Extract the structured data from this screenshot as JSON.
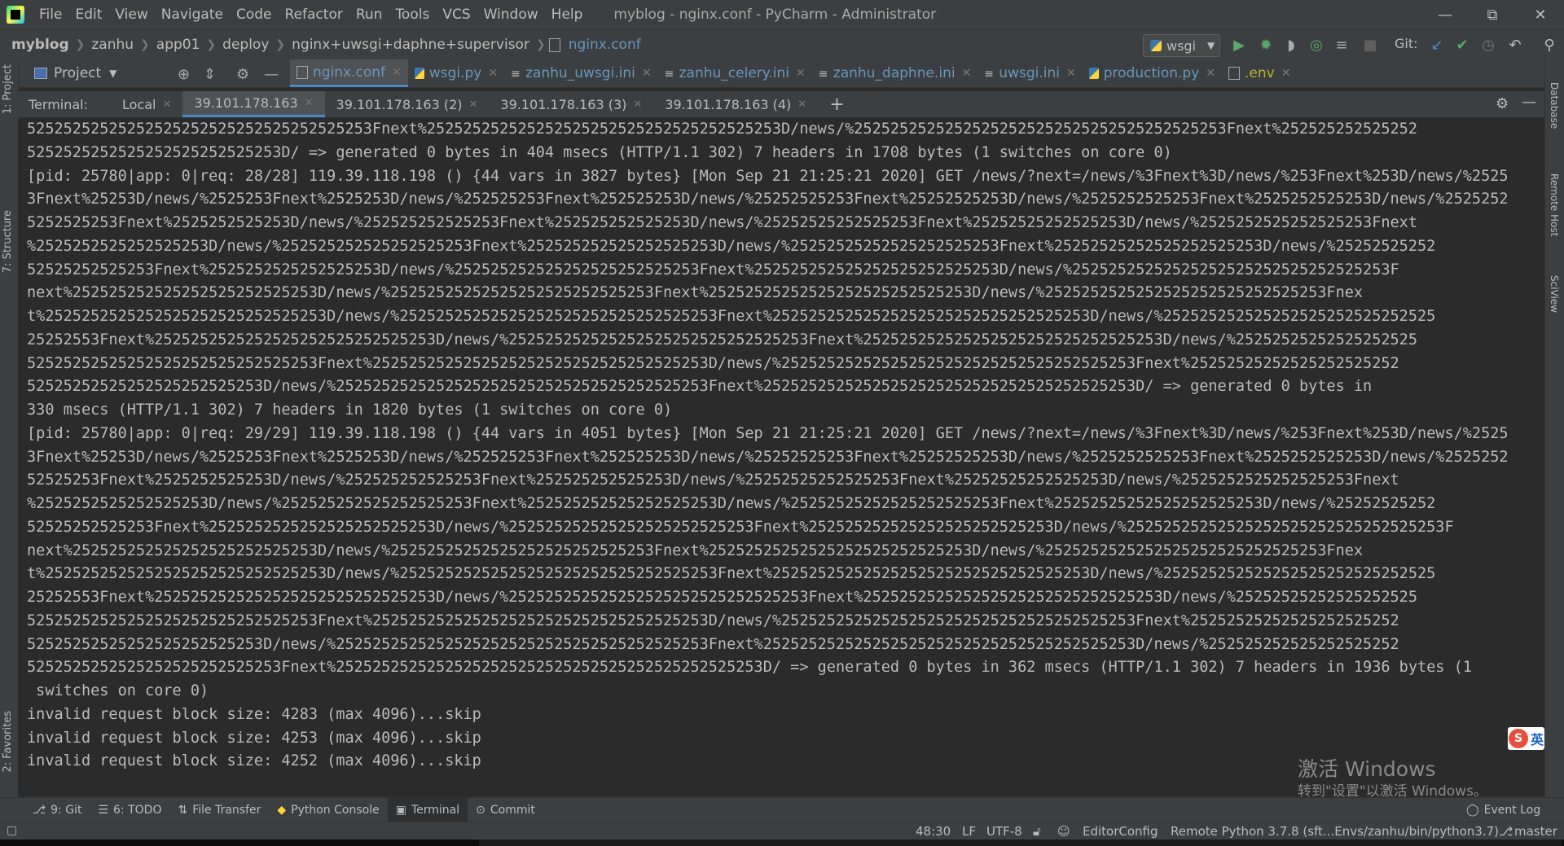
{
  "menu": [
    "File",
    "Edit",
    "View",
    "Navigate",
    "Code",
    "Refactor",
    "Run",
    "Tools",
    "VCS",
    "Window",
    "Help"
  ],
  "window_title": "myblog - nginx.conf - PyCharm - Administrator",
  "breadcrumbs": [
    "myblog",
    "zanhu",
    "app01",
    "deploy",
    "nginx+uwsgi+daphne+supervisor",
    "nginx.conf"
  ],
  "run_config": "wsgi",
  "git_label": "Git:",
  "project_label": "Project",
  "editor_tabs": [
    {
      "label": "nginx.conf"
    },
    {
      "label": "wsgi.py"
    },
    {
      "label": "zanhu_uwsgi.ini"
    },
    {
      "label": "zanhu_celery.ini"
    },
    {
      "label": "zanhu_daphne.ini"
    },
    {
      "label": "uwsgi.ini"
    },
    {
      "label": "production.py"
    },
    {
      "label": ".env"
    }
  ],
  "left_tools": [
    "1: Project",
    "7: Structure",
    "2: Favorites"
  ],
  "right_tools": [
    "Database",
    "Remote Host",
    "SciView"
  ],
  "terminal": {
    "title": "Terminal:",
    "tabs": [
      "Local",
      "39.101.178.163",
      "39.101.178.163 (2)",
      "39.101.178.163 (3)",
      "39.101.178.163 (4)"
    ],
    "lines": [
      "52525252525252525252525252525252525253Fnext%252525252525252525252525252525252525253D/news/%25252525252525252525252525252525252525253Fnext%252525252525252",
      "5252525252525252525252525253D/ => generated 0 bytes in 404 msecs (HTTP/1.1 302) 7 headers in 1708 bytes (1 switches on core 0)",
      "[pid: 25780|app: 0|req: 28/28] 119.39.118.198 () {44 vars in 3827 bytes} [Mon Sep 21 21:25:21 2020] GET /news/?next=/news/%3Fnext%3D/news/%253Fnext%253D/news/%2525",
      "3Fnext%25253D/news/%2525253Fnext%2525253D/news/%252525253Fnext%252525253D/news/%25252525253Fnext%25252525253D/news/%2525252525253Fnext%2525252525253D/news/%2525252",
      "5252525253Fnext%2525252525253D/news/%252525252525253Fnext%252525252525253D/news/%25252525252525253Fnext%25252525252525253D/news/%2525252525252525253Fnext",
      "%2525252525252525253D/news/%252525252525252525253Fnext%252525252525252525253D/news/%25252525252525252525253Fnext%25252525252525252525253D/news/%25252525252",
      "52525252525253Fnext%2525252525252525253D/news/%252525252525252525252525253Fnext%252525252525252525252525253D/news/%25252525252525252525252525252525253F",
      "next%252525252525252525252525253D/news/%25252525252525252525252525253Fnext%25252525252525252525252525253D/news/%2525252525252525252525252525253Fnex",
      "t%2525252525252525252525252525253D/news/%25252525252525252525252525252525253Fnext%25252525252525252525252525252525253D/news/%252525252525252525252525252525",
      "25252553Fnext%2525252525252525252525252525253D/news/%252525252525252525252525252525253Fnext%252525252525252525252525252525253D/news/%25252525252525252525",
      "52525252525252525252525252525253Fnext%2525252525252525252525252525252525253D/news/%252525252525252525252525252525252525253Fnext%25252525252525252525252",
      "52525252525252525252525253D/news/%25252525252525252525252525252525252525253Fnext%25252525252525252525252525252525252525253D/ => generated 0 bytes in",
      "330 msecs (HTTP/1.1 302) 7 headers in 1820 bytes (1 switches on core 0)",
      "[pid: 25780|app: 0|req: 29/29] 119.39.118.198 () {44 vars in 4051 bytes} [Mon Sep 21 21:25:21 2020] GET /news/?next=/news/%3Fnext%3D/news/%253Fnext%253D/news/%2525",
      "3Fnext%25253D/news/%2525253Fnext%2525253D/news/%252525253Fnext%252525253D/news/%25252525253Fnext%25252525253D/news/%2525252525253Fnext%2525252525253D/news/%2525252",
      "52525253Fnext%2525252525253D/news/%252525252525253Fnext%252525252525253D/news/%25252525252525253Fnext%25252525252525253D/news/%2525252525252525253Fnext",
      "%2525252525252525253D/news/%252525252525252525253Fnext%252525252525252525253D/news/%25252525252525252525253Fnext%25252525252525252525253D/news/%25252525252",
      "52525252525253Fnext%2525252525252525252525253D/news/%252525252525252525252525253Fnext%252525252525252525252525253D/news/%25252525252525252525252525252525253F",
      "next%252525252525252525252525253D/news/%25252525252525252525252525253Fnext%25252525252525252525252525253D/news/%2525252525252525252525252525253Fnex",
      "t%2525252525252525252525252525253D/news/%25252525252525252525252525252525253Fnext%25252525252525252525252525252525253D/news/%252525252525252525252525252525",
      "25252553Fnext%2525252525252525252525252525253D/news/%252525252525252525252525252525253Fnext%252525252525252525252525252525253D/news/%25252525252525252525",
      "52525252525252525252525252525253Fnext%2525252525252525252525252525252525253D/news/%252525252525252525252525252525252525253Fnext%25252525252525252525252",
      "52525252525252525252525253D/news/%25252525252525252525252525252525252525253Fnext%25252525252525252525252525252525252525253D/news/%252525252525252525252",
      "5252525252525252525252525253Fnext%25252525252525252525252525252525252525252525253D/ => generated 0 bytes in 362 msecs (HTTP/1.1 302) 7 headers in 1936 bytes (1",
      " switches on core 0)",
      "invalid request block size: 4283 (max 4096)...skip",
      "invalid request block size: 4253 (max 4096)...skip",
      "invalid request block size: 4252 (max 4096)...skip"
    ]
  },
  "watermark": {
    "line1": "激活 Windows",
    "line2": "转到\"设置\"以激活 Windows。"
  },
  "ime": {
    "mark": "S",
    "text": "英"
  },
  "bottom_tools": [
    {
      "label": "9: Git",
      "icon": "git-icon"
    },
    {
      "label": "6: TODO",
      "icon": "todo-icon"
    },
    {
      "label": "File Transfer",
      "icon": "file-transfer-icon"
    },
    {
      "label": "Python Console",
      "icon": "python-console-icon"
    },
    {
      "label": "Terminal",
      "icon": "terminal-icon"
    },
    {
      "label": "Commit",
      "icon": "commit-icon"
    }
  ],
  "event_log": "Event Log",
  "status": {
    "position": "48:30",
    "line_sep": "LF",
    "encoding": "UTF-8",
    "editorconfig": "EditorConfig",
    "interpreter": "Remote Python 3.7.8 (sft...Envs/zanhu/bin/python3.7)",
    "branch": "master"
  },
  "colors": {
    "accent": "#4a88c7",
    "background": "#2b2b2b",
    "panel": "#3c3f41"
  }
}
